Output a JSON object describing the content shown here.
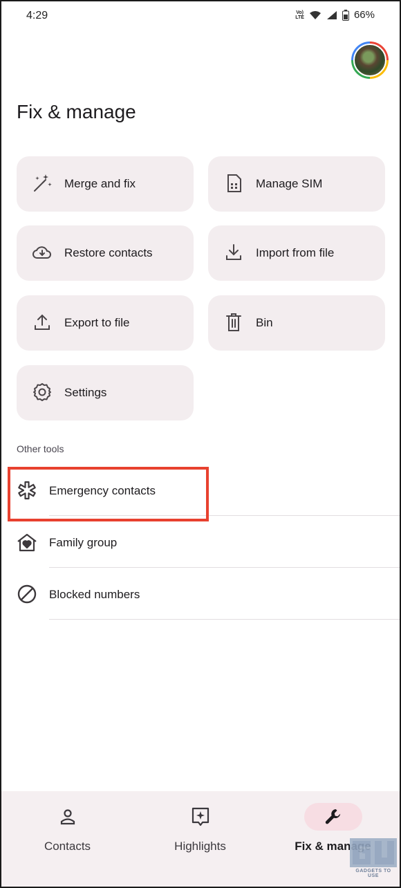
{
  "status_bar": {
    "time": "4:29",
    "network_label": "VoLTE",
    "battery": "66%"
  },
  "page": {
    "title": "Fix & manage"
  },
  "cards": [
    {
      "label": "Merge and fix",
      "icon": "magic-wand-icon"
    },
    {
      "label": "Manage SIM",
      "icon": "sim-card-icon"
    },
    {
      "label": "Restore contacts",
      "icon": "cloud-download-icon"
    },
    {
      "label": "Import from file",
      "icon": "download-icon"
    },
    {
      "label": "Export to file",
      "icon": "upload-icon"
    },
    {
      "label": "Bin",
      "icon": "trash-icon"
    },
    {
      "label": "Settings",
      "icon": "gear-icon"
    }
  ],
  "other_tools": {
    "heading": "Other tools",
    "items": [
      {
        "label": "Emergency contacts",
        "icon": "medical-asterisk-icon"
      },
      {
        "label": "Family group",
        "icon": "family-home-icon"
      },
      {
        "label": "Blocked numbers",
        "icon": "block-icon"
      }
    ]
  },
  "bottom_nav": [
    {
      "label": "Contacts",
      "icon": "person-icon",
      "active": false
    },
    {
      "label": "Highlights",
      "icon": "sparkle-icon",
      "active": false
    },
    {
      "label": "Fix & manage",
      "icon": "wrench-icon",
      "active": true
    }
  ],
  "watermark": {
    "text": "GADGETS TO USE"
  },
  "colors": {
    "card_bg": "#f3edef",
    "highlight_box": "#e8412f",
    "nav_active_pill": "#f7dde3",
    "nav_bg": "#f5eff1"
  }
}
